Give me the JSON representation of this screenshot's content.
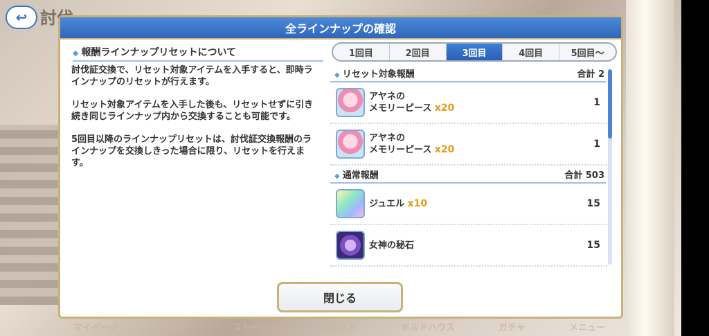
{
  "background": {
    "title": "討伐",
    "back_icon": "back-arrow-icon",
    "nav": [
      "マイページ",
      "ギルド",
      "ストーリー",
      "クエスト",
      "ギルドハウス",
      "ガチャ",
      "メニュー"
    ]
  },
  "dialog": {
    "title": "全ラインナップの確認",
    "left": {
      "heading": "報酬ラインナップリセットについて",
      "paragraphs": [
        "討伐証交換で、リセット対象アイテムを入手すると、即時ラインナップのリセットが行えます。",
        "リセット対象アイテムを入手した後も、リセットせずに引き続き同じラインナップ内から交換することも可能です。",
        "5回目以降のラインナップリセットは、討伐証交換報酬のラインナップを交換しきった場合に限り、リセットを行えます。"
      ]
    },
    "tabs": [
      "1回目",
      "2回目",
      "3回目",
      "4回目",
      "5回目～"
    ],
    "active_tab": 2,
    "sections": [
      {
        "label": "リセット対象報酬",
        "total": "合計 2",
        "items": [
          {
            "name": "アヤネの\nメモリーピース ",
            "mult": "x20",
            "qty": "1",
            "icon": "ayane-icon"
          },
          {
            "name": "アヤネの\nメモリーピース ",
            "mult": "x20",
            "qty": "1",
            "icon": "ayane-icon"
          }
        ]
      },
      {
        "label": "通常報酬",
        "total": "合計 503",
        "items": [
          {
            "name": "ジュエル ",
            "mult": "x10",
            "qty": "15",
            "icon": "jewel-icon"
          },
          {
            "name": "女神の秘石",
            "mult": "",
            "qty": "15",
            "icon": "goddess-stone-icon"
          }
        ]
      }
    ],
    "close_label": "閉じる"
  }
}
